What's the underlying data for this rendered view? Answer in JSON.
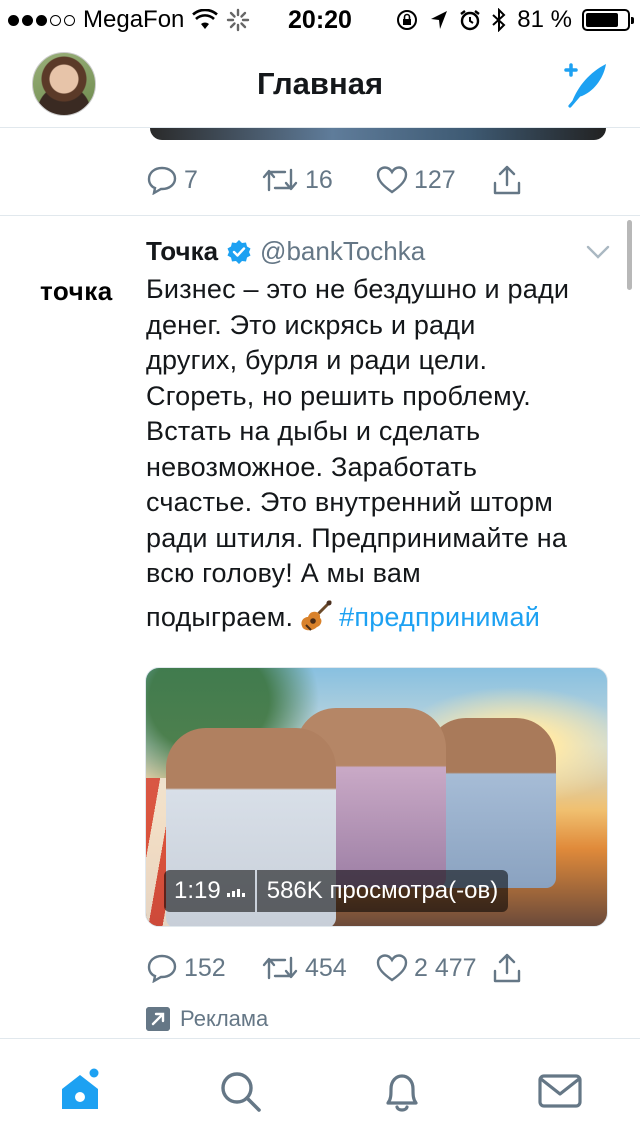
{
  "status_bar": {
    "carrier": "MegaFon",
    "time": "20:20",
    "battery_percent": "81 %",
    "battery_level": 0.81,
    "signal_bars_filled": 3,
    "signal_bars_total": 5
  },
  "header": {
    "title": "Главная",
    "compose_icon": "compose-tweet-icon",
    "avatar_icon": "profile-avatar"
  },
  "previous_tweet": {
    "replies": "7",
    "retweets": "16",
    "likes": "127"
  },
  "tweet": {
    "brand_logo": "точка",
    "name": "Точка",
    "handle": "@bankTochka",
    "verified": true,
    "text_lines": [
      "Бизнес – это не бездушно и ради",
      "денег. Это искрясь и ради",
      "других, бурля и ради цели.",
      "Сгореть, но решить проблему.",
      "Встать на дыбы и сделать",
      "невозможное. Заработать",
      "счастье. Это внутренний шторм",
      "ради штиля. Предпринимайте на",
      "всю голову! А мы вам"
    ],
    "last_line_text": "подыграем.",
    "emoji": "guitar-emoji",
    "hashtag": "#предпринимай",
    "video": {
      "duration": "1:19",
      "views": "586K просмотра(-ов)"
    },
    "replies": "152",
    "retweets": "454",
    "likes": "2 477",
    "promoted_label": "Реклама"
  },
  "tab_bar": {
    "items": [
      "home-icon",
      "search-icon",
      "notifications-icon",
      "messages-icon"
    ],
    "active": "home-icon"
  },
  "colors": {
    "accent": "#1da1f2",
    "secondary_text": "#657786",
    "divider": "#e1e8ed"
  }
}
